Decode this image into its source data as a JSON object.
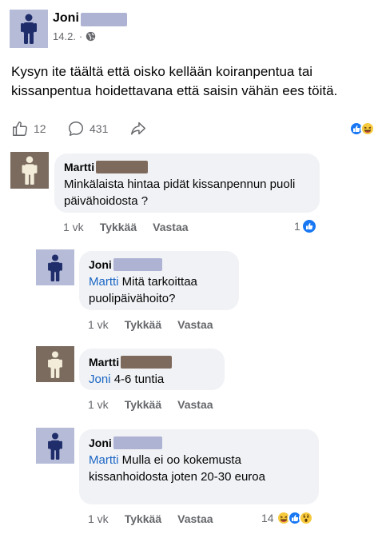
{
  "post": {
    "author": "Joni",
    "date": "14.2.",
    "separator": "·",
    "privacy_icon": "globe-icon",
    "text": "Kysyn ite täältä että oisko kellään koiranpentua tai kissanpentua hoidettavana että saisin vähän ees töitä.",
    "like_count": "12",
    "comment_count": "431",
    "reactions": [
      "like",
      "haha"
    ]
  },
  "colors": {
    "accent": "#1a65c4",
    "joni_avatar_bg": "#b6bcd8",
    "joni_redact": "#aeb3d4",
    "martti_avatar_bg": "#7a6b5e",
    "martti_redact": "#7e6a5d",
    "bubble_bg": "#f0f2f5"
  },
  "comments": [
    {
      "author": "Martti",
      "mention": "",
      "text": "Minkälaista hintaa pidät kissanpennun puoli päivähoidosta ?",
      "time": "1 vk",
      "like_label": "Tykkää",
      "reply_label": "Vastaa",
      "reaction_count": "1",
      "reactions": [
        "like"
      ]
    },
    {
      "author": "Joni",
      "mention": "Martti",
      "text": "Mitä tarkoittaa puolipäivähoito?",
      "time": "1 vk",
      "like_label": "Tykkää",
      "reply_label": "Vastaa",
      "reaction_count": "",
      "reactions": []
    },
    {
      "author": "Martti",
      "mention": "Joni",
      "text": "4-6 tuntia",
      "time": "1 vk",
      "like_label": "Tykkää",
      "reply_label": "Vastaa",
      "reaction_count": "",
      "reactions": []
    },
    {
      "author": "Joni",
      "mention": "Martti",
      "text": "Mulla ei oo kokemusta kissanhoidosta joten 20-30 euroa",
      "time": "1 vk",
      "like_label": "Tykkää",
      "reply_label": "Vastaa",
      "reaction_count": "14",
      "reactions": [
        "haha",
        "like",
        "wow"
      ]
    }
  ]
}
